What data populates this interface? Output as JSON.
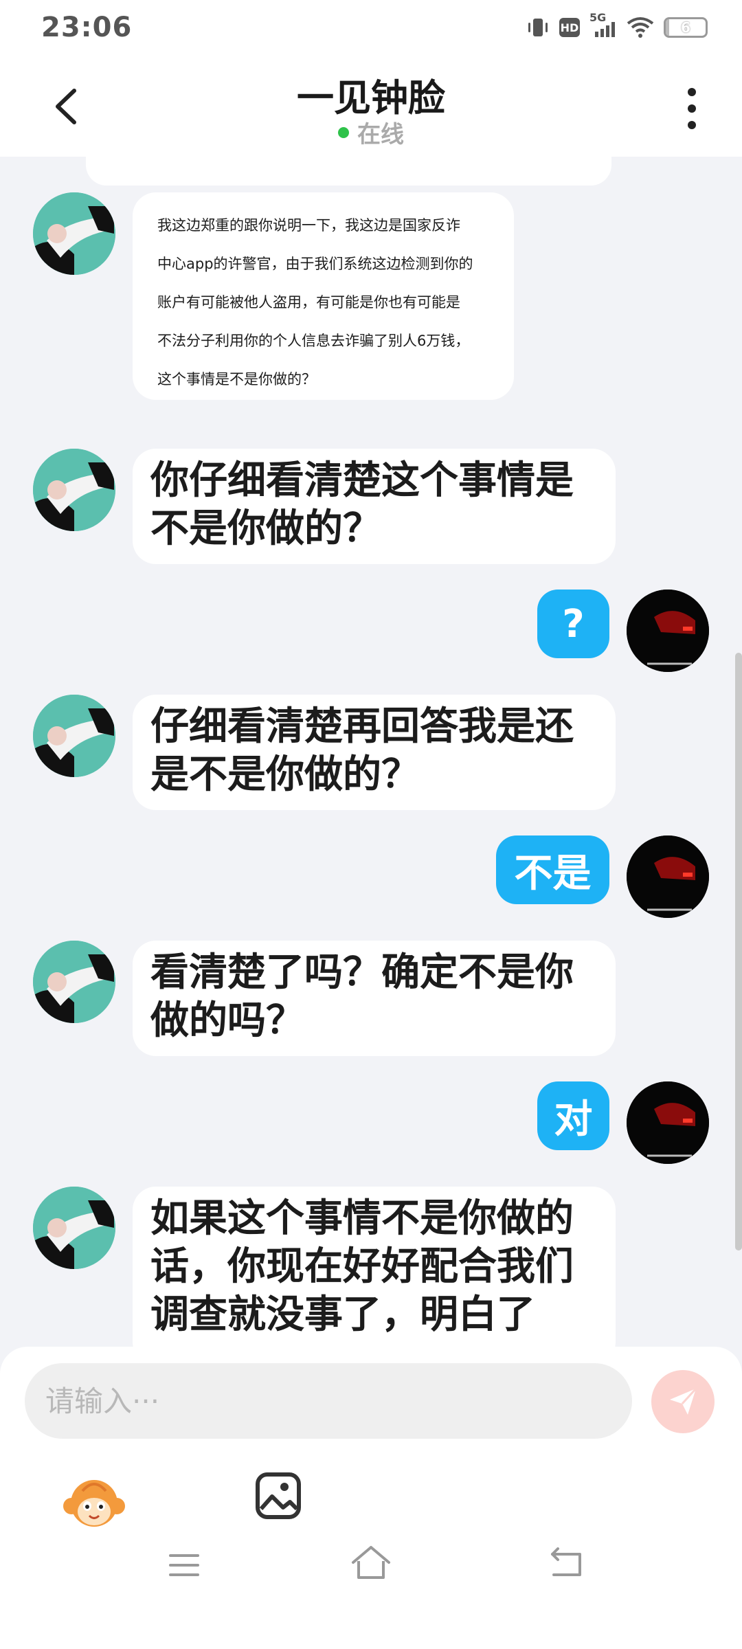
{
  "status_bar": {
    "time": "23:06",
    "hd_label": "HD",
    "network_label": "5G",
    "battery_level": "6",
    "battery_fraction": 0.06
  },
  "header": {
    "title": "一见钟脸",
    "online_status": "在线",
    "online_color": "#2ec24a"
  },
  "messages": [
    {
      "from": "other",
      "text_lines": [
        "我这边郑重的跟你说明一下，我这边是国家反诈",
        "中心app的许警官，由于我们系统这边检测到你的",
        "账户有可能被他人盗用，有可能是你也有可能是",
        "不法分子利用你的个人信息去诈骗了别人6万钱，",
        "这个事情是不是你做的？"
      ]
    },
    {
      "from": "other",
      "text_lines": [
        "你仔细看清楚这个事情是",
        "不是你做的？"
      ]
    },
    {
      "from": "me",
      "text": "?"
    },
    {
      "from": "other",
      "text_lines": [
        "仔细看清楚再回答我是还",
        "是不是你做的？"
      ]
    },
    {
      "from": "me",
      "text": "不是"
    },
    {
      "from": "other",
      "text_lines": [
        "看清楚了吗？确定不是你",
        "做的吗？"
      ]
    },
    {
      "from": "me",
      "text": "对"
    },
    {
      "from": "other",
      "text_lines": [
        "如果这个事情不是你做的",
        "话，你现在好好配合我们",
        "调查就没事了，明白了"
      ]
    }
  ],
  "input": {
    "placeholder": "请输入···",
    "value": ""
  },
  "colors": {
    "my_bubble": "#1eb2f5",
    "send_button": "#fcd3cf",
    "background": "#f2f3f7"
  },
  "icons": {
    "back": "chevron-left-icon",
    "more": "more-vertical-icon",
    "send": "paper-plane-icon",
    "sticker": "monkey-sticker-icon",
    "image": "image-icon",
    "nav_menu": "menu-icon",
    "nav_home": "home-icon",
    "nav_back": "back-icon"
  }
}
